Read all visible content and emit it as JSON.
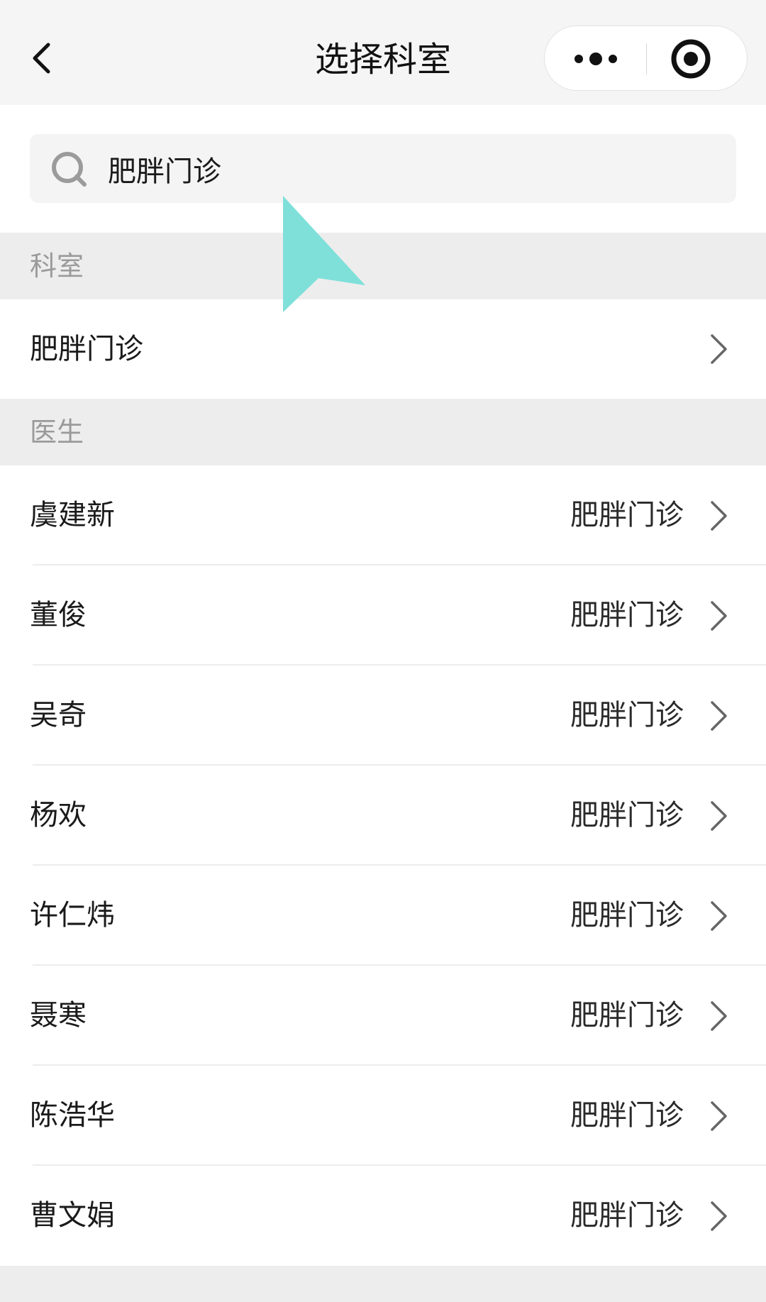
{
  "nav": {
    "title": "选择科室",
    "back_icon": "chevron-left-icon",
    "more_icon": "more-dots-icon",
    "close_icon": "target-close-icon"
  },
  "search": {
    "value": "肥胖门诊",
    "icon": "search-icon"
  },
  "sections": {
    "department": {
      "header": "科室",
      "items": [
        {
          "name": "肥胖门诊"
        }
      ]
    },
    "doctor": {
      "header": "医生",
      "items": [
        {
          "name": "虞建新",
          "dept": "肥胖门诊"
        },
        {
          "name": "董俊",
          "dept": "肥胖门诊"
        },
        {
          "name": "吴奇",
          "dept": "肥胖门诊"
        },
        {
          "name": "杨欢",
          "dept": "肥胖门诊"
        },
        {
          "name": "许仁炜",
          "dept": "肥胖门诊"
        },
        {
          "name": "聂寒",
          "dept": "肥胖门诊"
        },
        {
          "name": "陈浩华",
          "dept": "肥胖门诊"
        },
        {
          "name": "曹文娟",
          "dept": "肥胖门诊"
        }
      ]
    }
  },
  "colors": {
    "nav_background": "#f5f5f5",
    "section_background": "#ededed",
    "row_background": "#ffffff",
    "cursor": "#7fe0d9"
  }
}
